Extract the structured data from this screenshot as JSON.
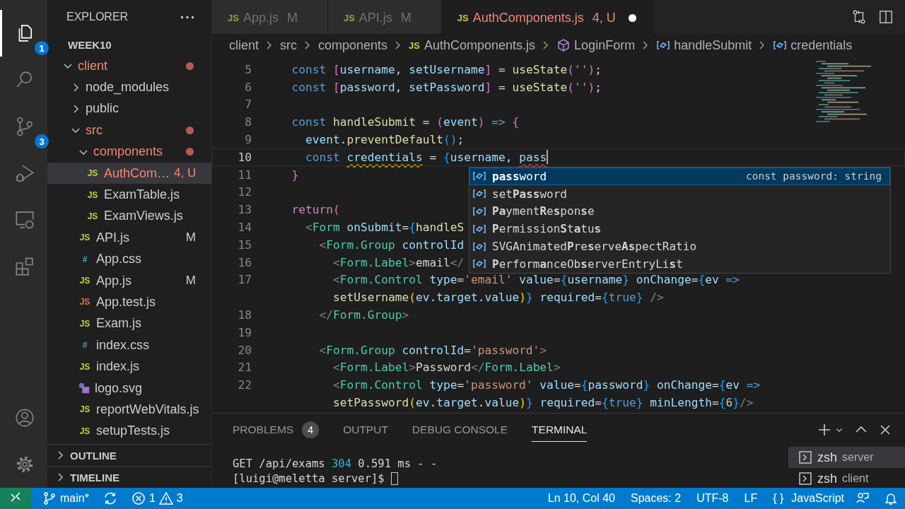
{
  "activity_bar": [
    {
      "kind": "files",
      "badge": "1",
      "selected": true
    },
    {
      "kind": "search",
      "selected": false
    },
    {
      "kind": "source-control",
      "badge": "3",
      "selected": false
    },
    {
      "kind": "run-debug",
      "selected": false
    },
    {
      "kind": "remote",
      "selected": false
    },
    {
      "kind": "extensions",
      "selected": false
    }
  ],
  "activity_bar_bottom": [
    {
      "kind": "account"
    },
    {
      "kind": "settings"
    }
  ],
  "sidebar": {
    "title": "EXPLORER",
    "workspace": "WEEK10",
    "tree": [
      {
        "name": "client",
        "kind": "folder",
        "expanded": true,
        "selected": false,
        "problem": true,
        "children": [
          {
            "name": "node_modules",
            "kind": "folder",
            "expanded": false,
            "selected": false,
            "problem": false
          },
          {
            "name": "public",
            "kind": "folder",
            "expanded": false,
            "selected": false,
            "problem": false
          },
          {
            "name": "src",
            "kind": "folder",
            "expanded": true,
            "selected": false,
            "problem": true,
            "children": [
              {
                "name": "components",
                "kind": "folder",
                "expanded": true,
                "selected": false,
                "problem": true,
                "children": [
                  {
                    "name": "AuthCom…",
                    "kind": "js",
                    "glyph": "JS",
                    "badge": "4, U",
                    "selected": true,
                    "problem": true
                  },
                  {
                    "name": "ExamTable.js",
                    "kind": "js",
                    "glyph": "JS",
                    "selected": false,
                    "problem": false
                  },
                  {
                    "name": "ExamViews.js",
                    "kind": "js",
                    "glyph": "JS",
                    "selected": false,
                    "problem": false
                  }
                ]
              },
              {
                "name": "API.js",
                "kind": "js",
                "glyph": "JS",
                "badge": "M",
                "selected": false,
                "problem": false
              },
              {
                "name": "App.css",
                "kind": "css",
                "glyph": "#",
                "selected": false,
                "problem": false
              },
              {
                "name": "App.js",
                "kind": "js",
                "glyph": "JS",
                "badge": "M",
                "selected": false,
                "problem": false
              },
              {
                "name": "App.test.js",
                "kind": "test",
                "glyph": "JS",
                "selected": false,
                "problem": false
              },
              {
                "name": "Exam.js",
                "kind": "js",
                "glyph": "JS",
                "selected": false,
                "problem": false
              },
              {
                "name": "index.css",
                "kind": "css",
                "glyph": "#",
                "selected": false,
                "problem": false
              },
              {
                "name": "index.js",
                "kind": "js",
                "glyph": "JS",
                "selected": false,
                "problem": false
              },
              {
                "name": "logo.svg",
                "kind": "svg",
                "selected": false,
                "problem": false
              },
              {
                "name": "reportWebVitals.js",
                "kind": "js",
                "glyph": "JS",
                "selected": false,
                "problem": false
              },
              {
                "name": "setupTests.js",
                "kind": "js",
                "glyph": "JS",
                "selected": false,
                "problem": false
              }
            ]
          }
        ]
      }
    ],
    "sections": [
      {
        "title": "OUTLINE",
        "expanded": false
      },
      {
        "title": "TIMELINE",
        "expanded": false
      }
    ]
  },
  "editor_tabs": [
    {
      "glyph": "JS",
      "name": "App.js",
      "badge": "M",
      "selected": false,
      "problem": false,
      "dirty": false
    },
    {
      "glyph": "JS",
      "name": "API.js",
      "badge": "M",
      "selected": false,
      "problem": false,
      "dirty": false
    },
    {
      "glyph": "JS",
      "name": "AuthComponents.js",
      "badge": "4, U",
      "selected": true,
      "problem": true,
      "dirty": true
    }
  ],
  "breadcrumb": [
    {
      "text": "client",
      "kind": "folder"
    },
    {
      "text": "src",
      "kind": "folder"
    },
    {
      "text": "components",
      "kind": "folder"
    },
    {
      "text": "AuthComponents.js",
      "kind": "file",
      "glyph": "JS"
    },
    {
      "text": "LoginForm",
      "kind": "component"
    },
    {
      "text": "handleSubmit",
      "kind": "variable"
    },
    {
      "text": "credentials",
      "kind": "variable"
    }
  ],
  "code_lines": [
    {
      "number": "5",
      "current": false,
      "tokens": [
        {
          "text": "  const ",
          "kind": "kw"
        },
        {
          "text": "[",
          "kind": "br2"
        },
        {
          "text": "username",
          "kind": "var"
        },
        {
          "text": ", ",
          "kind": "txt"
        },
        {
          "text": "setUsername",
          "kind": "var"
        },
        {
          "text": "]",
          "kind": "br2"
        },
        {
          "text": " = ",
          "kind": "txt"
        },
        {
          "text": "useState",
          "kind": "fn"
        },
        {
          "text": "(",
          "kind": "br2"
        },
        {
          "text": "''",
          "kind": "str"
        },
        {
          "text": ")",
          "kind": "br2"
        },
        {
          "text": ";",
          "kind": "txt"
        }
      ]
    },
    {
      "number": "6",
      "current": false,
      "tokens": [
        {
          "text": "  const ",
          "kind": "kw"
        },
        {
          "text": "[",
          "kind": "br2"
        },
        {
          "text": "password",
          "kind": "var"
        },
        {
          "text": ", ",
          "kind": "txt"
        },
        {
          "text": "setPassword",
          "kind": "var"
        },
        {
          "text": "]",
          "kind": "br2"
        },
        {
          "text": " = ",
          "kind": "txt"
        },
        {
          "text": "useState",
          "kind": "fn"
        },
        {
          "text": "(",
          "kind": "br2"
        },
        {
          "text": "''",
          "kind": "str"
        },
        {
          "text": ")",
          "kind": "br2"
        },
        {
          "text": ";",
          "kind": "txt"
        }
      ]
    },
    {
      "number": "7",
      "current": false
    },
    {
      "number": "8",
      "current": false,
      "tokens": [
        {
          "text": "  const ",
          "kind": "kw"
        },
        {
          "text": "handleSubmit",
          "kind": "fn"
        },
        {
          "text": " = ",
          "kind": "txt"
        },
        {
          "text": "(",
          "kind": "br2"
        },
        {
          "text": "event",
          "kind": "var"
        },
        {
          "text": ")",
          "kind": "br2"
        },
        {
          "text": " =>",
          "kind": "kw"
        },
        {
          "text": " {",
          "kind": "br2"
        }
      ]
    },
    {
      "number": "9",
      "current": false,
      "tokens": [
        {
          "text": "    event",
          "kind": "var"
        },
        {
          "text": ".",
          "kind": "txt"
        },
        {
          "text": "preventDefault",
          "kind": "fn"
        },
        {
          "text": "(",
          "kind": "br3"
        },
        {
          "text": ")",
          "kind": "br3"
        },
        {
          "text": ";",
          "kind": "txt"
        }
      ]
    },
    {
      "number": "10",
      "current": true,
      "tokens": [
        {
          "text": "    const ",
          "kind": "kw"
        },
        {
          "text": "credentials",
          "kind": "varwarn"
        },
        {
          "text": " = ",
          "kind": "txt"
        },
        {
          "text": "{",
          "kind": "br3"
        },
        {
          "text": "username",
          "kind": "var"
        },
        {
          "text": ", ",
          "kind": "txt"
        },
        {
          "text": "pass",
          "kind": "varerr"
        }
      ]
    },
    {
      "number": "11",
      "current": false,
      "tokens": [
        {
          "text": "  }",
          "kind": "br2"
        }
      ]
    },
    {
      "number": "12",
      "current": false
    },
    {
      "number": "13",
      "current": false,
      "tokens": [
        {
          "text": "  return",
          "kind": "ctl"
        },
        {
          "text": "(",
          "kind": "br2"
        }
      ]
    },
    {
      "number": "14",
      "current": false,
      "tokens": [
        {
          "text": "    <",
          "kind": "ang"
        },
        {
          "text": "Form ",
          "kind": "tag"
        },
        {
          "text": "onSubmit",
          "kind": "var"
        },
        {
          "text": "=",
          "kind": "txt"
        },
        {
          "text": "{",
          "kind": "br3"
        },
        {
          "text": "handleS",
          "kind": "fn"
        }
      ]
    },
    {
      "number": "15",
      "current": false,
      "tokens": [
        {
          "text": "      <",
          "kind": "ang"
        },
        {
          "text": "Form.Group ",
          "kind": "tag"
        },
        {
          "text": "controlId",
          "kind": "var"
        }
      ]
    },
    {
      "number": "16",
      "current": false,
      "tokens": [
        {
          "text": "        <",
          "kind": "ang"
        },
        {
          "text": "Form.Label",
          "kind": "tag"
        },
        {
          "text": ">",
          "kind": "ang"
        },
        {
          "text": "email",
          "kind": "txt"
        },
        {
          "text": "</",
          "kind": "ang"
        }
      ]
    },
    {
      "number": "17",
      "current": false,
      "tokens": [
        {
          "text": "        <",
          "kind": "ang"
        },
        {
          "text": "Form.Control ",
          "kind": "tag"
        },
        {
          "text": "type",
          "kind": "var"
        },
        {
          "text": "=",
          "kind": "txt"
        },
        {
          "text": "'email'",
          "kind": "str"
        },
        {
          "text": " value",
          "kind": "var"
        },
        {
          "text": "=",
          "kind": "txt"
        },
        {
          "text": "{",
          "kind": "br3"
        },
        {
          "text": "username",
          "kind": "var"
        },
        {
          "text": "}",
          "kind": "br3"
        },
        {
          "text": " onChange",
          "kind": "var"
        },
        {
          "text": "=",
          "kind": "txt"
        },
        {
          "text": "{",
          "kind": "br3"
        },
        {
          "text": "ev",
          "kind": "var"
        },
        {
          "text": " =>",
          "kind": "kw"
        }
      ]
    },
    {
      "current": false,
      "tokens": [
        {
          "text": "        setUsername",
          "kind": "fn"
        },
        {
          "text": "(",
          "kind": "br1"
        },
        {
          "text": "ev",
          "kind": "var"
        },
        {
          "text": ".",
          "kind": "txt"
        },
        {
          "text": "target",
          "kind": "var"
        },
        {
          "text": ".",
          "kind": "txt"
        },
        {
          "text": "value",
          "kind": "var"
        },
        {
          "text": ")",
          "kind": "br1"
        },
        {
          "text": "}",
          "kind": "br3"
        },
        {
          "text": " required",
          "kind": "var"
        },
        {
          "text": "=",
          "kind": "txt"
        },
        {
          "text": "{",
          "kind": "br3"
        },
        {
          "text": "true",
          "kind": "kw"
        },
        {
          "text": "}",
          "kind": "br3"
        },
        {
          "text": " />",
          "kind": "ang"
        }
      ]
    },
    {
      "number": "18",
      "current": false,
      "tokens": [
        {
          "text": "      </",
          "kind": "ang"
        },
        {
          "text": "Form.Group",
          "kind": "tag"
        },
        {
          "text": ">",
          "kind": "ang"
        }
      ]
    },
    {
      "number": "19",
      "current": false
    },
    {
      "number": "20",
      "current": false,
      "tokens": [
        {
          "text": "      <",
          "kind": "ang"
        },
        {
          "text": "Form.Group ",
          "kind": "tag"
        },
        {
          "text": "controlId",
          "kind": "var"
        },
        {
          "text": "=",
          "kind": "txt"
        },
        {
          "text": "'password'",
          "kind": "str"
        },
        {
          "text": ">",
          "kind": "ang"
        }
      ]
    },
    {
      "number": "21",
      "current": false,
      "tokens": [
        {
          "text": "        <",
          "kind": "ang"
        },
        {
          "text": "Form.Label",
          "kind": "tag"
        },
        {
          "text": ">",
          "kind": "ang"
        },
        {
          "text": "Password",
          "kind": "txt"
        },
        {
          "text": "</",
          "kind": "ang"
        },
        {
          "text": "Form.Label",
          "kind": "tag"
        },
        {
          "text": ">",
          "kind": "ang"
        }
      ]
    },
    {
      "number": "22",
      "current": false,
      "tokens": [
        {
          "text": "        <",
          "kind": "ang"
        },
        {
          "text": "Form.Control ",
          "kind": "tag"
        },
        {
          "text": "type",
          "kind": "var"
        },
        {
          "text": "=",
          "kind": "txt"
        },
        {
          "text": "'password'",
          "kind": "str"
        },
        {
          "text": " value",
          "kind": "var"
        },
        {
          "text": "=",
          "kind": "txt"
        },
        {
          "text": "{",
          "kind": "br3"
        },
        {
          "text": "password",
          "kind": "var"
        },
        {
          "text": "}",
          "kind": "br3"
        },
        {
          "text": " onChange",
          "kind": "var"
        },
        {
          "text": "=",
          "kind": "txt"
        },
        {
          "text": "{",
          "kind": "br3"
        },
        {
          "text": "ev",
          "kind": "var"
        },
        {
          "text": " =>",
          "kind": "kw"
        }
      ]
    },
    {
      "current": false,
      "tokens": [
        {
          "text": "        setPassword",
          "kind": "fn"
        },
        {
          "text": "(",
          "kind": "br1"
        },
        {
          "text": "ev",
          "kind": "var"
        },
        {
          "text": ".",
          "kind": "txt"
        },
        {
          "text": "target",
          "kind": "var"
        },
        {
          "text": ".",
          "kind": "txt"
        },
        {
          "text": "value",
          "kind": "var"
        },
        {
          "text": ")",
          "kind": "br1"
        },
        {
          "text": "}",
          "kind": "br3"
        },
        {
          "text": " required",
          "kind": "var"
        },
        {
          "text": "=",
          "kind": "txt"
        },
        {
          "text": "{",
          "kind": "br3"
        },
        {
          "text": "true",
          "kind": "kw"
        },
        {
          "text": "}",
          "kind": "br3"
        },
        {
          "text": " minLength",
          "kind": "var"
        },
        {
          "text": "=",
          "kind": "txt"
        },
        {
          "text": "{",
          "kind": "br3"
        },
        {
          "text": "6",
          "kind": "num"
        },
        {
          "text": "}",
          "kind": "br3"
        },
        {
          "text": "/>",
          "kind": "ang"
        }
      ]
    }
  ],
  "suggestions": [
    {
      "label": "**pass**word",
      "selected": true,
      "detail": "const password: string"
    },
    {
      "label": "set**Pass**word",
      "selected": false
    },
    {
      "label": "**Pa**yment**R**e**s**pon**s**e",
      "selected": false
    },
    {
      "label": "**P**ermission**S**t**a**tu**s**",
      "selected": false
    },
    {
      "label": "SVGAnimated**P**re**s**erve**As**pectRatio",
      "selected": false
    },
    {
      "label": "**P**erform**a**nceOb**s**erverEntryLi**s**t",
      "selected": false
    }
  ],
  "panel": {
    "tabs": [
      {
        "label": "PROBLEMS",
        "count": "4",
        "selected": false
      },
      {
        "label": "OUTPUT",
        "selected": false
      },
      {
        "label": "DEBUG CONSOLE",
        "selected": false
      },
      {
        "label": "TERMINAL",
        "selected": true
      }
    ],
    "terminal_lines": [
      [
        {
          "text": "GET /api/exams ",
          "kind": "txt"
        },
        {
          "text": "304",
          "kind": "num"
        },
        {
          "text": " 0.591 ms - -",
          "kind": "txt"
        }
      ],
      [
        {
          "text": "[luigi@meletta server]$ ",
          "kind": "txt"
        }
      ]
    ],
    "terminals": [
      {
        "shell": "zsh",
        "name": "server",
        "selected": true
      },
      {
        "shell": "zsh",
        "name": "client",
        "selected": false
      }
    ]
  },
  "status_bar": {
    "branch": "main*",
    "errors": "1",
    "warnings": "3",
    "items": [
      "Ln 10, Col 40",
      "Spaces: 2",
      "UTF-8",
      "LF"
    ],
    "language_glyph": "{ }",
    "language": "JavaScript"
  }
}
